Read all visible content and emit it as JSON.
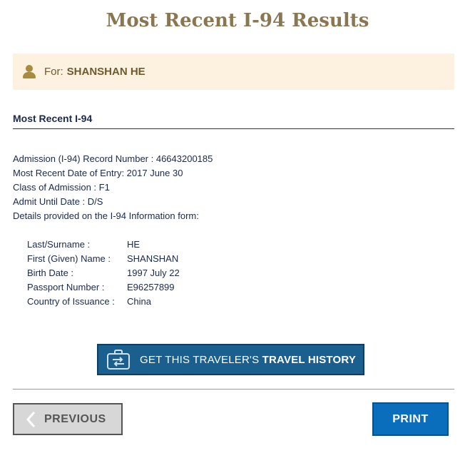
{
  "page": {
    "title": "Most Recent I-94 Results"
  },
  "traveler": {
    "for_label": "For:",
    "name": "SHANSHAN HE"
  },
  "section": {
    "title": "Most Recent I-94"
  },
  "record": {
    "rows": [
      "Admission (I-94) Record Number : 46643200185",
      "Most Recent Date of Entry: 2017 June 30",
      "Class of Admission : F1",
      "Admit Until Date : D/S",
      "Details provided on the I-94 Information form:"
    ]
  },
  "details": [
    {
      "label": "Last/Surname :",
      "value": "HE"
    },
    {
      "label": "First (Given) Name :",
      "value": "SHANSHAN"
    },
    {
      "label": "Birth Date :",
      "value": "1997 July 22"
    },
    {
      "label": "Passport Number :",
      "value": "E96257899"
    },
    {
      "label": "Country of Issuance :",
      "value": "China"
    }
  ],
  "history_button": {
    "prefix": "GET THIS TRAVELER'S ",
    "emphasis": "TRAVEL HISTORY",
    "icon": "briefcase-arrows-icon"
  },
  "footer": {
    "previous_label": "PREVIOUS",
    "print_label": "PRINT"
  },
  "colors": {
    "title": "#8a7650",
    "banner_bg": "#fdf1e0",
    "primary": "#0a6ebd",
    "history_btn": "#1b5f8f"
  }
}
